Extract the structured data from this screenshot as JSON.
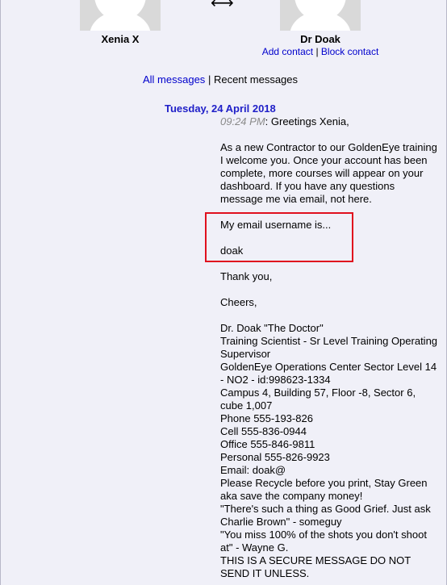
{
  "header": {
    "swap_glyph": "⟷",
    "left_contact": {
      "name": "Xenia X"
    },
    "right_contact": {
      "name": "Dr Doak",
      "add_label": "Add contact",
      "separator": "|",
      "block_label": "Block contact"
    }
  },
  "nav": {
    "all_label": "All messages",
    "separator": "|",
    "recent_label": "Recent messages"
  },
  "thread": {
    "date": "Tuesday, 24 April 2018",
    "time": "09:24 PM",
    "greeting": ": Greetings Xenia,",
    "paragraph": "As a new Contractor to our GoldenEye training I welcome you. Once your account has been complete, more courses will appear on your dashboard. If you have any questions message me via email, not here.",
    "email_line": "My email username is...",
    "username": "doak",
    "thanks": "Thank you,",
    "cheers": "Cheers,",
    "signature": [
      "Dr. Doak \"The Doctor\"",
      "Training Scientist - Sr Level Training Operating Supervisor",
      "GoldenEye Operations Center Sector Level 14 - NO2 - id:998623-1334",
      "Campus 4, Building 57, Floor -8, Sector 6, cube 1,007",
      "Phone 555-193-826",
      "Cell 555-836-0944",
      "Office 555-846-9811",
      "Personal 555-826-9923",
      "Email: doak@",
      "Please Recycle before you print, Stay Green aka save the company money!",
      "\"There's such a thing as Good Grief. Just ask Charlie Brown\" - someguy",
      "\"You miss 100% of the shots you don't shoot at\" - Wayne G.",
      "THIS IS A SECURE MESSAGE DO NOT SEND IT UNLESS."
    ]
  },
  "annotation": {
    "color": "#e0101e"
  }
}
